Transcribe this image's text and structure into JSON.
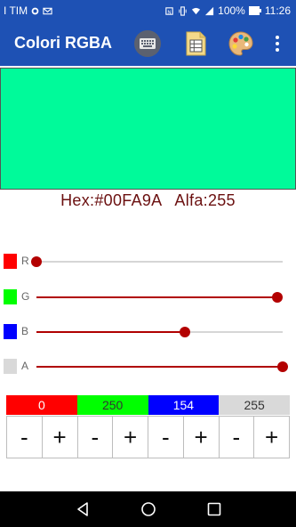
{
  "status_bar": {
    "carrier": "I TIM",
    "battery": "100%",
    "time": "11:26"
  },
  "app_bar": {
    "title": "Colori RGBA",
    "actions": [
      "keyboard-icon",
      "spreadsheet-icon",
      "palette-icon",
      "more-vert-icon"
    ]
  },
  "preview": {
    "color": "#00FA9A"
  },
  "info": {
    "hex_text": "Hex:#00FA9A",
    "alpha_text": "Alfa:255"
  },
  "channels": [
    {
      "key": "r",
      "label": "R",
      "swatch_color": "#ff0000",
      "value": 0,
      "value_text": "0",
      "fraction": 0.0
    },
    {
      "key": "g",
      "label": "G",
      "swatch_color": "#00ff00",
      "value": 250,
      "value_text": "250",
      "fraction": 0.98
    },
    {
      "key": "b",
      "label": "B",
      "swatch_color": "#0000ff",
      "value": 154,
      "value_text": "154",
      "fraction": 0.604
    },
    {
      "key": "a",
      "label": "A",
      "swatch_color": "#d9d9d9",
      "value": 255,
      "value_text": "255",
      "fraction": 1.0
    }
  ],
  "controls": {
    "minus_label": "-",
    "plus_label": "+"
  },
  "colors": {
    "app_bar": "#1e51b4",
    "slider_accent": "#b00000",
    "hex_text": "#6b1010"
  }
}
